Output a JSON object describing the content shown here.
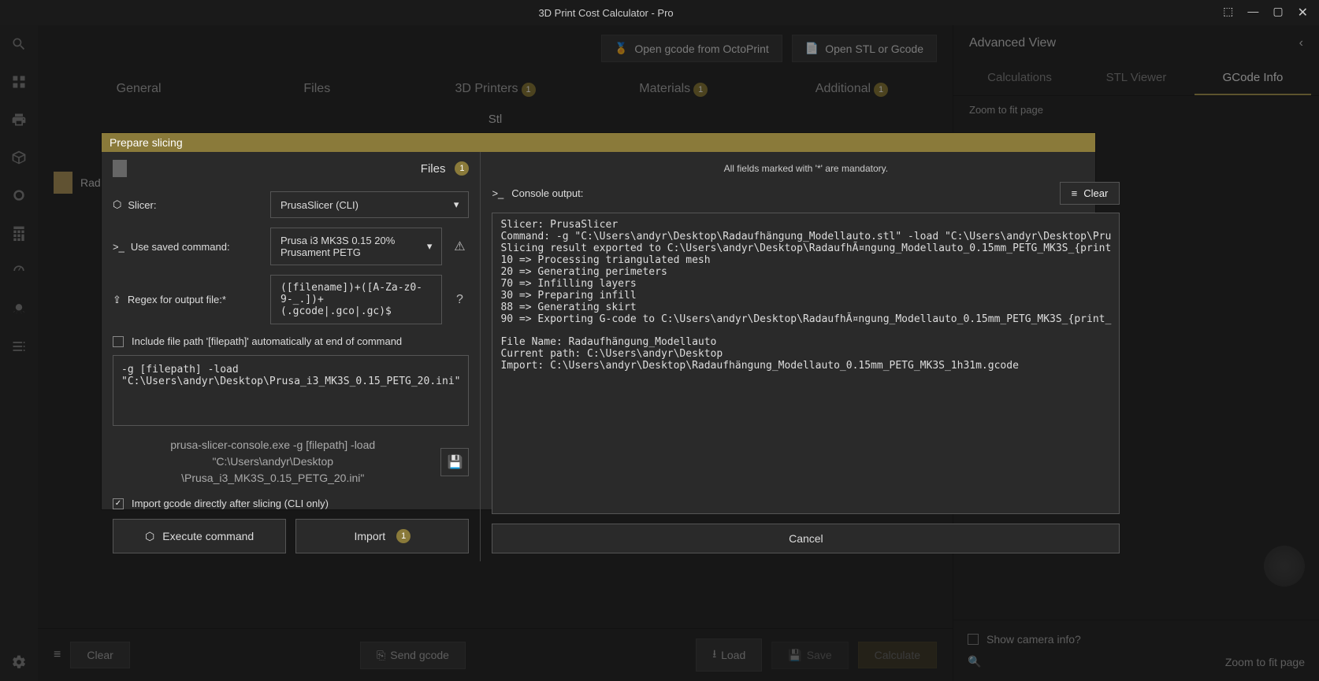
{
  "titlebar": {
    "title": "3D Print Cost Calculator - Pro"
  },
  "topButtons": {
    "octoprint": "Open gcode from OctoPrint",
    "openstl": "Open STL or Gcode"
  },
  "tabs": {
    "general": "General",
    "files": "Files",
    "printers": "3D Printers",
    "materials": "Materials",
    "additional": "Additional",
    "badge": "1"
  },
  "subhead": "Stl",
  "fileItem": {
    "name": "Rad..."
  },
  "bottom": {
    "clear": "Clear",
    "sendgcode": "Send gcode",
    "load": "Load",
    "save": "Save",
    "calculate": "Calculate"
  },
  "rightPanel": {
    "title": "Advanced View",
    "tabs": {
      "calc": "Calculations",
      "stl": "STL Viewer",
      "gcode": "GCode Info"
    },
    "zoom": "Zoom to fit page",
    "showCamera": "Show camera info?",
    "zoomBtn": "Zoom to fit page"
  },
  "dialog": {
    "title": "Prepare slicing",
    "filesLabel": "Files",
    "filesBadge": "1",
    "slicerLabel": "Slicer:",
    "slicerValue": "PrusaSlicer (CLI)",
    "savedCmdLabel": "Use saved command:",
    "savedCmdValue": "Prusa i3 MK3S 0.15 20% Prusament PETG",
    "regexLabel": "Regex for output file:*",
    "regexValue": "([filename])+([A-Za-z0-9-_.])+(.gcode|.gco|.gc)$",
    "includeFilepath": "Include file path '[filepath]' automatically at end of command",
    "commandText": "-g [filepath] -load \"C:\\Users\\andyr\\Desktop\\Prusa_i3_MK3S_0.15_PETG_20.ini\"",
    "commandPreview1": "prusa-slicer-console.exe -g [filepath] -load \"C:\\Users\\andyr\\Desktop",
    "commandPreview2": "\\Prusa_i3_MK3S_0.15_PETG_20.ini\"",
    "importAfter": "Import gcode directly after slicing (CLI only)",
    "executeBtn": "Execute command",
    "importBtn": "Import",
    "importBadge": "1",
    "mandatory": "All fields marked with '*' are mandatory.",
    "consoleLabel": "Console output:",
    "clearBtn": "Clear",
    "consoleText": "Slicer: PrusaSlicer\nCommand: -g \"C:\\Users\\andyr\\Desktop\\Radaufhängung_Modellauto.stl\" -load \"C:\\Users\\andyr\\Desktop\\Pru\nSlicing result exported to C:\\Users\\andyr\\Desktop\\RadaufhÃ¤ngung_Modellauto_0.15mm_PETG_MK3S_{print\n10 => Processing triangulated mesh\n20 => Generating perimeters\n70 => Infilling layers\n30 => Preparing infill\n88 => Generating skirt\n90 => Exporting G-code to C:\\Users\\andyr\\Desktop\\RadaufhÃ¤ngung_Modellauto_0.15mm_PETG_MK3S_{print_\n\nFile Name: Radaufhängung_Modellauto\nCurrent path: C:\\Users\\andyr\\Desktop\nImport: C:\\Users\\andyr\\Desktop\\Radaufhängung_Modellauto_0.15mm_PETG_MK3S_1h31m.gcode",
    "cancelBtn": "Cancel"
  }
}
